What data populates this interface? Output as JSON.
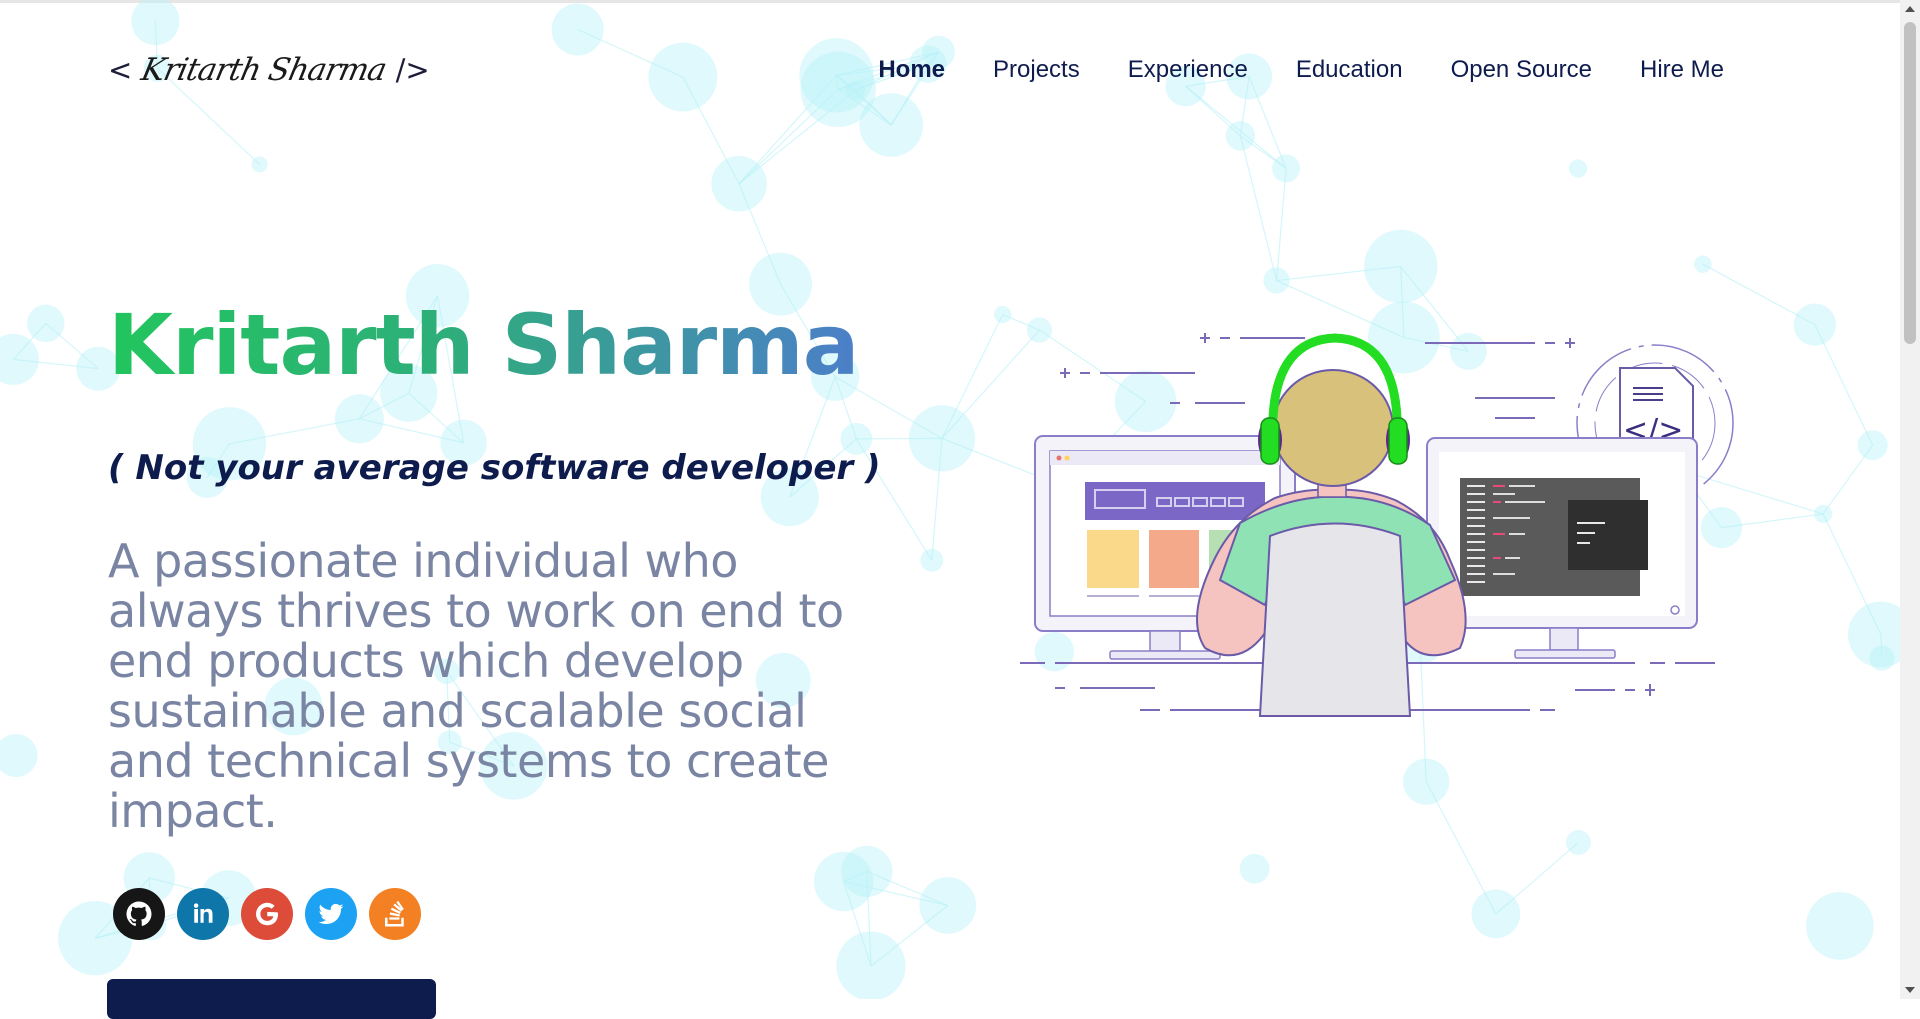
{
  "logo": {
    "open": "<",
    "signature": "Kritarth Sharma",
    "close": "/>"
  },
  "nav": {
    "items": [
      {
        "label": "Home",
        "active": true
      },
      {
        "label": "Projects"
      },
      {
        "label": "Experience"
      },
      {
        "label": "Education"
      },
      {
        "label": "Open Source"
      },
      {
        "label": "Hire Me"
      }
    ]
  },
  "hero": {
    "title": "Kritarth Sharma",
    "tagline": "( Not your average software developer )",
    "bio": "A passionate individual who always thrives to work on end to end products which develop sustainable and scalable social and technical systems to create impact."
  },
  "socials": [
    {
      "icon": "github-icon",
      "color": "#161616"
    },
    {
      "icon": "linkedin-icon",
      "color": "#0e76a8"
    },
    {
      "icon": "google-icon",
      "color": "#dd4b39"
    },
    {
      "icon": "twitter-icon",
      "color": "#1da1f2"
    },
    {
      "icon": "stackoverflow-icon",
      "color": "#f48024"
    }
  ],
  "illustration": {
    "code_symbol": "</>"
  },
  "colors": {
    "navy": "#0e1b4d",
    "title_gradient_start": "#22c55e",
    "title_gradient_end": "#4c7fc9",
    "bio_text": "#7a84a3",
    "particle": "#b8f1f8"
  }
}
